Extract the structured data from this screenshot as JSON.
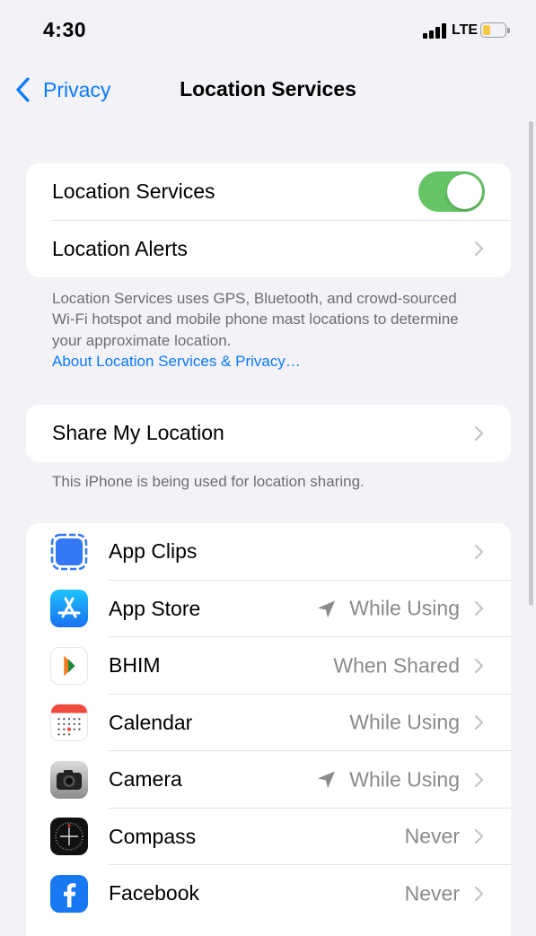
{
  "status": {
    "time": "4:30",
    "network": "LTE",
    "battery_color": "#f7c945"
  },
  "nav": {
    "back_label": "Privacy",
    "title": "Location Services"
  },
  "main_group": {
    "location_services_label": "Location Services",
    "location_services_on": true,
    "location_alerts_label": "Location Alerts"
  },
  "info": {
    "text": "Location Services uses GPS, Bluetooth, and crowd-sourced Wi-Fi hotspot and mobile phone mast locations to determine your approximate location.",
    "link": "About Location Services & Privacy…"
  },
  "share": {
    "label": "Share My Location",
    "footer": "This iPhone is being used for location sharing."
  },
  "apps": [
    {
      "name": "App Clips",
      "value": "",
      "icon": "app-clips-icon",
      "recent_use": false
    },
    {
      "name": "App Store",
      "value": "While Using",
      "icon": "app-store-icon",
      "recent_use": true
    },
    {
      "name": "BHIM",
      "value": "When Shared",
      "icon": "bhim-icon",
      "recent_use": false
    },
    {
      "name": "Calendar",
      "value": "While Using",
      "icon": "calendar-icon",
      "recent_use": false
    },
    {
      "name": "Camera",
      "value": "While Using",
      "icon": "camera-icon",
      "recent_use": true
    },
    {
      "name": "Compass",
      "value": "Never",
      "icon": "compass-icon",
      "recent_use": false
    },
    {
      "name": "Facebook",
      "value": "Never",
      "icon": "facebook-icon",
      "recent_use": false
    }
  ],
  "colors": {
    "accent": "#0a7aff",
    "toggle_on": "#65c466",
    "background": "#f2f2f7"
  }
}
